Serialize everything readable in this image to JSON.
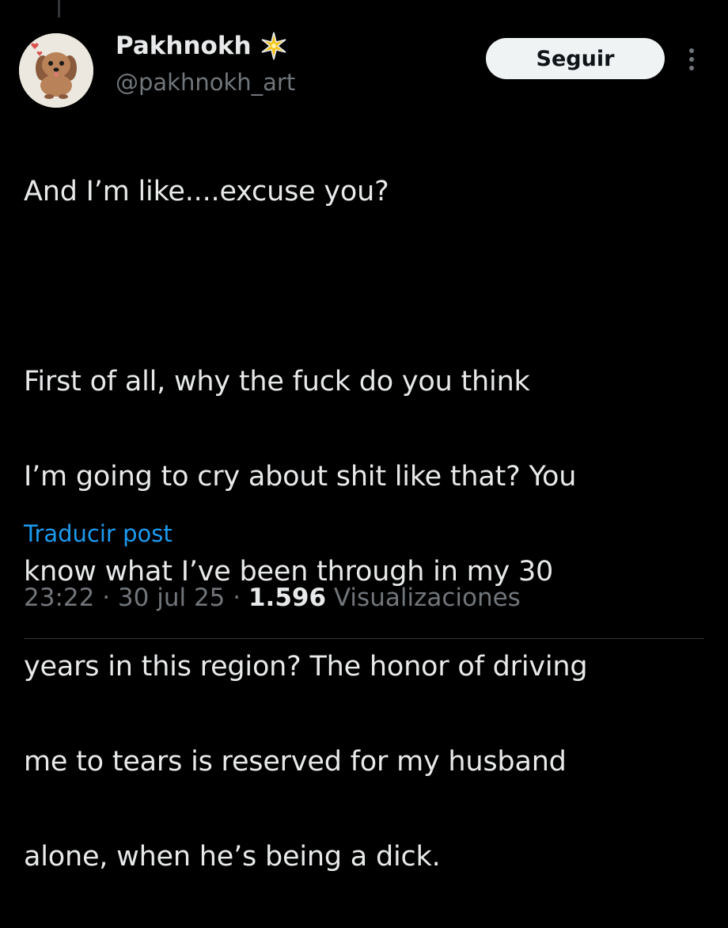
{
  "post": {
    "author": {
      "display_name": "Pakhnokh",
      "handle": "@pakhnokh_art",
      "avatar_icon": "dog-avatar",
      "badge_icon": "sparkle-icon"
    },
    "follow_label": "Seguir",
    "more_icon": "more-vertical-icon",
    "text": {
      "line1": "And I’m like....excuse you?",
      "para2": [
        "First of all, why the fuck do you think",
        "I’m going to cry about shit like that? You",
        "know what I’ve been through in my 30",
        "years in this region? The honor of driving",
        "me to tears is reserved for my husband",
        "alone, when he’s being a dick."
      ]
    },
    "translate_label": "Traducir post",
    "time": "23:22",
    "separator": "·",
    "date": "30 jul 25",
    "views_count": "1.596",
    "views_label": "Visualizaciones"
  },
  "colors": {
    "background": "#000000",
    "text": "#e7e9ea",
    "secondary": "#71767b",
    "link": "#1d9bf0",
    "button_bg": "#eff3f4"
  }
}
